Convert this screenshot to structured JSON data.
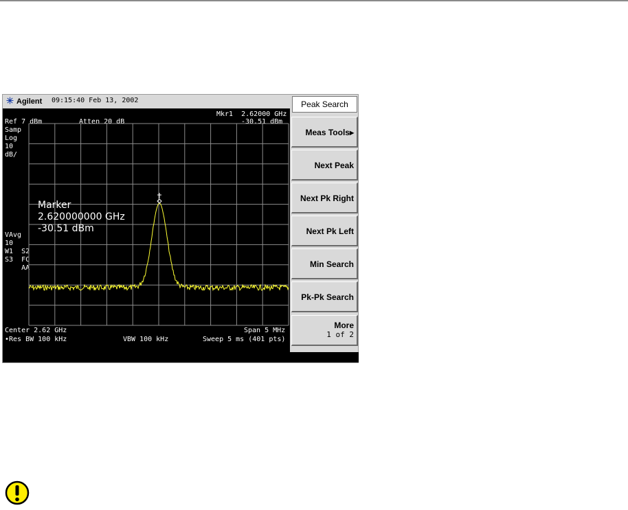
{
  "header": {
    "brand": "Agilent",
    "datetime": "09:15:40  Feb 13, 2002"
  },
  "screen": {
    "marker_top_label": "Mkr1  2.62000 GHz",
    "ref_level": "Ref 7 dBm",
    "atten": "Atten 20 dB",
    "marker_top_value": "-30.51 dBm",
    "left_annotations_top": [
      "Samp",
      "Log",
      "10",
      "dB/"
    ],
    "left_annotations_mid": [
      "VAvg",
      "10",
      "W1  S2",
      "S3  FC",
      "    AA"
    ],
    "marker_readout": {
      "title": "Marker",
      "frequency": "2.620000000 GHz",
      "amplitude": "-30.51 dBm"
    },
    "center": "Center 2.62 GHz",
    "span": "Span 5 MHz",
    "res_bw": "•Res BW 100 kHz",
    "vbw": "VBW 100 kHz",
    "sweep": "Sweep 5 ms (401 pts)"
  },
  "softkeys": {
    "title": "Peak Search",
    "keys": [
      {
        "label": "Meas Tools▸"
      },
      {
        "label": "Next Peak"
      },
      {
        "label": "Next Pk Right"
      },
      {
        "label": "Next Pk Left"
      },
      {
        "label": "Min Search"
      },
      {
        "label": "Pk-Pk Search"
      },
      {
        "label": "More",
        "sub": "1 of 2"
      }
    ]
  },
  "colors": {
    "trace": "#ffff33",
    "grid": "#8c8c8c",
    "screen_bg": "#000000",
    "caution": "#ffee00"
  },
  "icons": {
    "brand": "agilent-spark-icon",
    "caution": "caution-exclamation-icon"
  }
}
